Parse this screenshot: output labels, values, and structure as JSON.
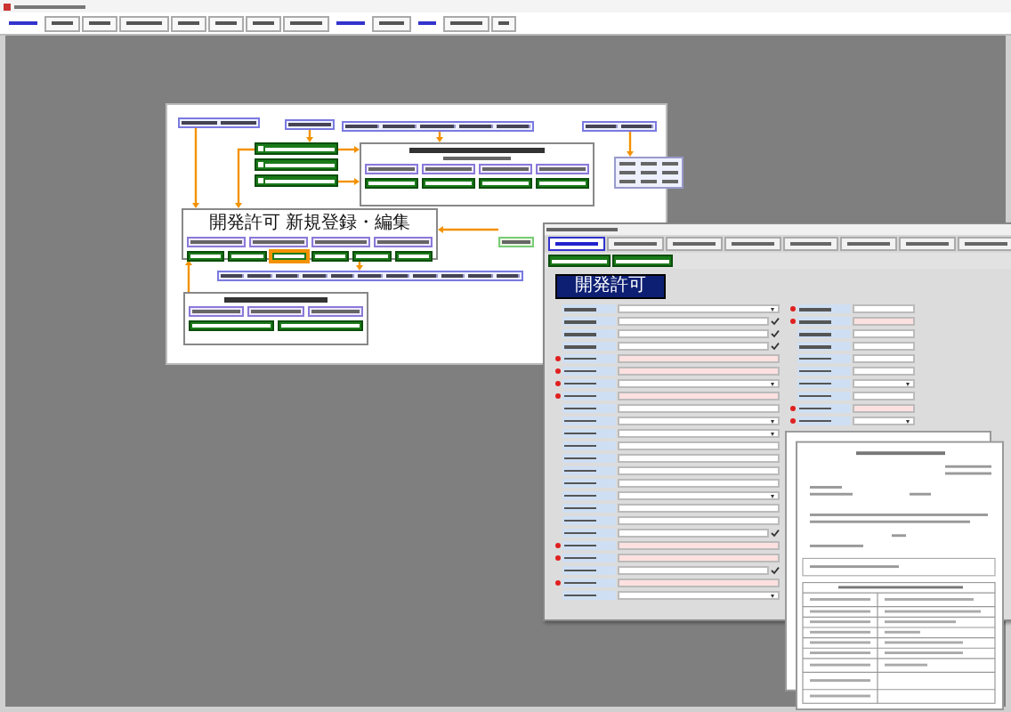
{
  "menu": [
    {
      "kind": "link"
    },
    {
      "kind": "button"
    },
    {
      "kind": "button"
    },
    {
      "kind": "button"
    },
    {
      "kind": "button"
    },
    {
      "kind": "button"
    },
    {
      "kind": "button"
    },
    {
      "kind": "button"
    },
    {
      "kind": "link"
    },
    {
      "kind": "button"
    },
    {
      "kind": "link"
    },
    {
      "kind": "button"
    },
    {
      "kind": "button"
    }
  ],
  "diagram": {
    "detail_title": "開発許可 新規登録・編集",
    "action_buttons": [
      {
        "highlighted": false
      },
      {
        "highlighted": false
      },
      {
        "highlighted": true
      },
      {
        "highlighted": false
      },
      {
        "highlighted": false
      },
      {
        "highlighted": false
      }
    ]
  },
  "form": {
    "title": "開発許可",
    "tabs": [
      {
        "selected": true
      },
      {
        "selected": false
      },
      {
        "selected": false
      },
      {
        "selected": false
      },
      {
        "selected": false
      },
      {
        "selected": false
      },
      {
        "selected": false
      },
      {
        "selected": false
      }
    ],
    "fields_left": [
      {
        "kind": "dropdown",
        "required": false
      },
      {
        "kind": "check",
        "required": false
      },
      {
        "kind": "check",
        "required": false
      },
      {
        "kind": "check",
        "required": false
      },
      {
        "kind": "pink",
        "required": true
      },
      {
        "kind": "pink",
        "required": true
      },
      {
        "kind": "dropdown",
        "required": true
      },
      {
        "kind": "pink",
        "required": true
      },
      {
        "kind": "plain",
        "required": false
      },
      {
        "kind": "dropdown",
        "required": false
      },
      {
        "kind": "dropdown",
        "required": false
      },
      {
        "kind": "plain",
        "required": false
      },
      {
        "kind": "plain",
        "required": false
      },
      {
        "kind": "plain",
        "required": false
      },
      {
        "kind": "plain",
        "required": false
      },
      {
        "kind": "dropdown",
        "required": false
      },
      {
        "kind": "plain",
        "required": false
      },
      {
        "kind": "plain",
        "required": false
      },
      {
        "kind": "check",
        "required": false
      },
      {
        "kind": "pink",
        "required": true
      },
      {
        "kind": "pink",
        "required": true
      },
      {
        "kind": "check",
        "required": false
      },
      {
        "kind": "pink",
        "required": true
      },
      {
        "kind": "dropdown",
        "required": false
      }
    ],
    "fields_right": [
      {
        "kind": "plain",
        "required": true
      },
      {
        "kind": "pink",
        "required": true
      },
      {
        "kind": "plain",
        "required": false
      },
      {
        "kind": "plain",
        "required": false
      },
      {
        "kind": "plain",
        "required": false
      },
      {
        "kind": "plain",
        "required": false
      },
      {
        "kind": "dropdown",
        "required": false
      },
      {
        "kind": "plain",
        "required": false
      },
      {
        "kind": "pink",
        "required": true
      },
      {
        "kind": "dropdown",
        "required": true
      }
    ]
  }
}
